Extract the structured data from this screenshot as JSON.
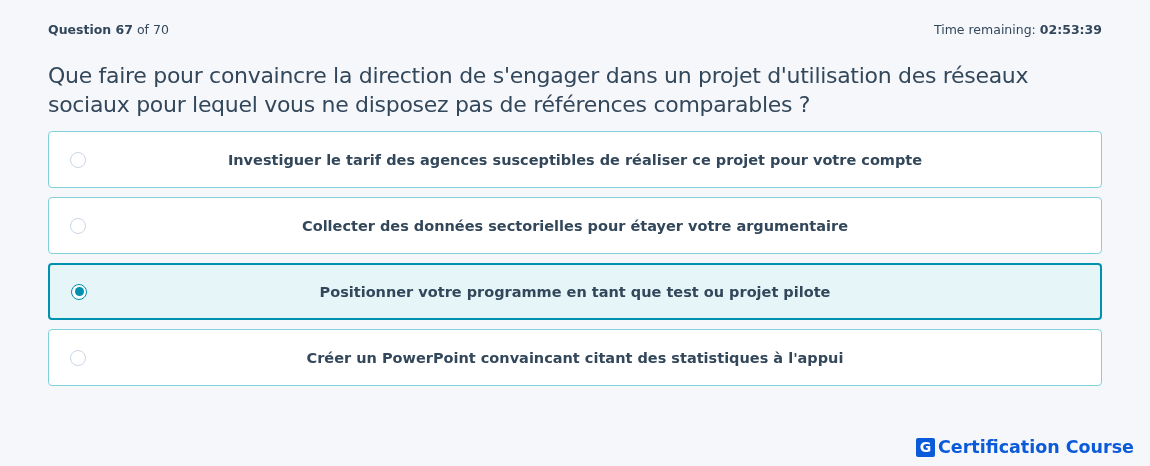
{
  "header": {
    "progress": "**Question 67** of 70",
    "timer": "Time remaining: **02:53:39**"
  },
  "question": "Que faire pour convaincre la direction de s'engager dans un projet d'utilisation des réseaux sociaux pour lequel vous ne disposez pas de références comparables ?",
  "options": [
    {
      "label": "Investiguer le tarif des agences susceptibles de réaliser ce projet pour votre compte",
      "selected": false
    },
    {
      "label": "Collecter des données sectorielles pour étayer votre argumentaire",
      "selected": false
    },
    {
      "label": "Positionner votre programme en tant que test ou projet pilote",
      "selected": true
    },
    {
      "label": "Créer un PowerPoint convaincant citant des statistiques à l'appui",
      "selected": false
    }
  ],
  "footer": {
    "logo_mark": "G",
    "logo_text": "Certification Course"
  }
}
